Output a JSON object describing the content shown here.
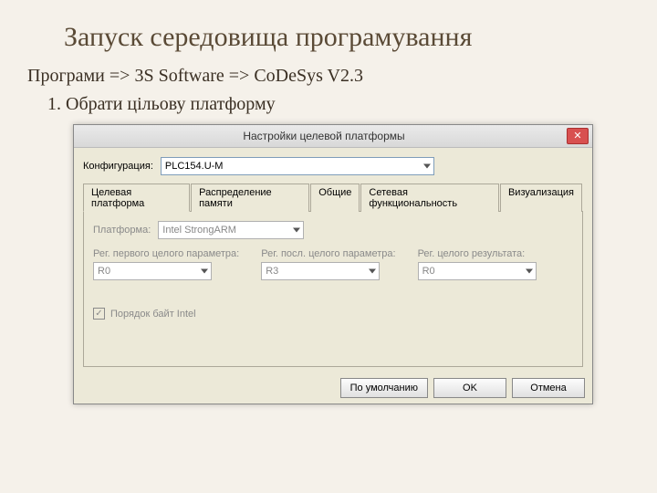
{
  "heading": "Запуск середовища програмування",
  "path_text": "Програми => 3S Software => CoDeSys V2.3",
  "step_1": "Обрати цільову платформу",
  "dialog": {
    "title": "Настройки целевой платформы",
    "config_label": "Конфигурация:",
    "config_value": "PLC154.U-M",
    "tabs": [
      "Целевая платформа",
      "Распределение памяти",
      "Общие",
      "Сетевая функциональность",
      "Визуализация"
    ],
    "platform_label": "Платформа:",
    "platform_value": "Intel StrongARM",
    "regs": [
      {
        "label": "Рег. первого целого параметра:",
        "value": "R0"
      },
      {
        "label": "Рег. посл. целого параметра:",
        "value": "R3"
      },
      {
        "label": "Рег. целого результата:",
        "value": "R0"
      }
    ],
    "byteorder_label": "Порядок байт Intel",
    "buttons": {
      "default": "По умолчанию",
      "ok": "OK",
      "cancel": "Отмена"
    }
  }
}
